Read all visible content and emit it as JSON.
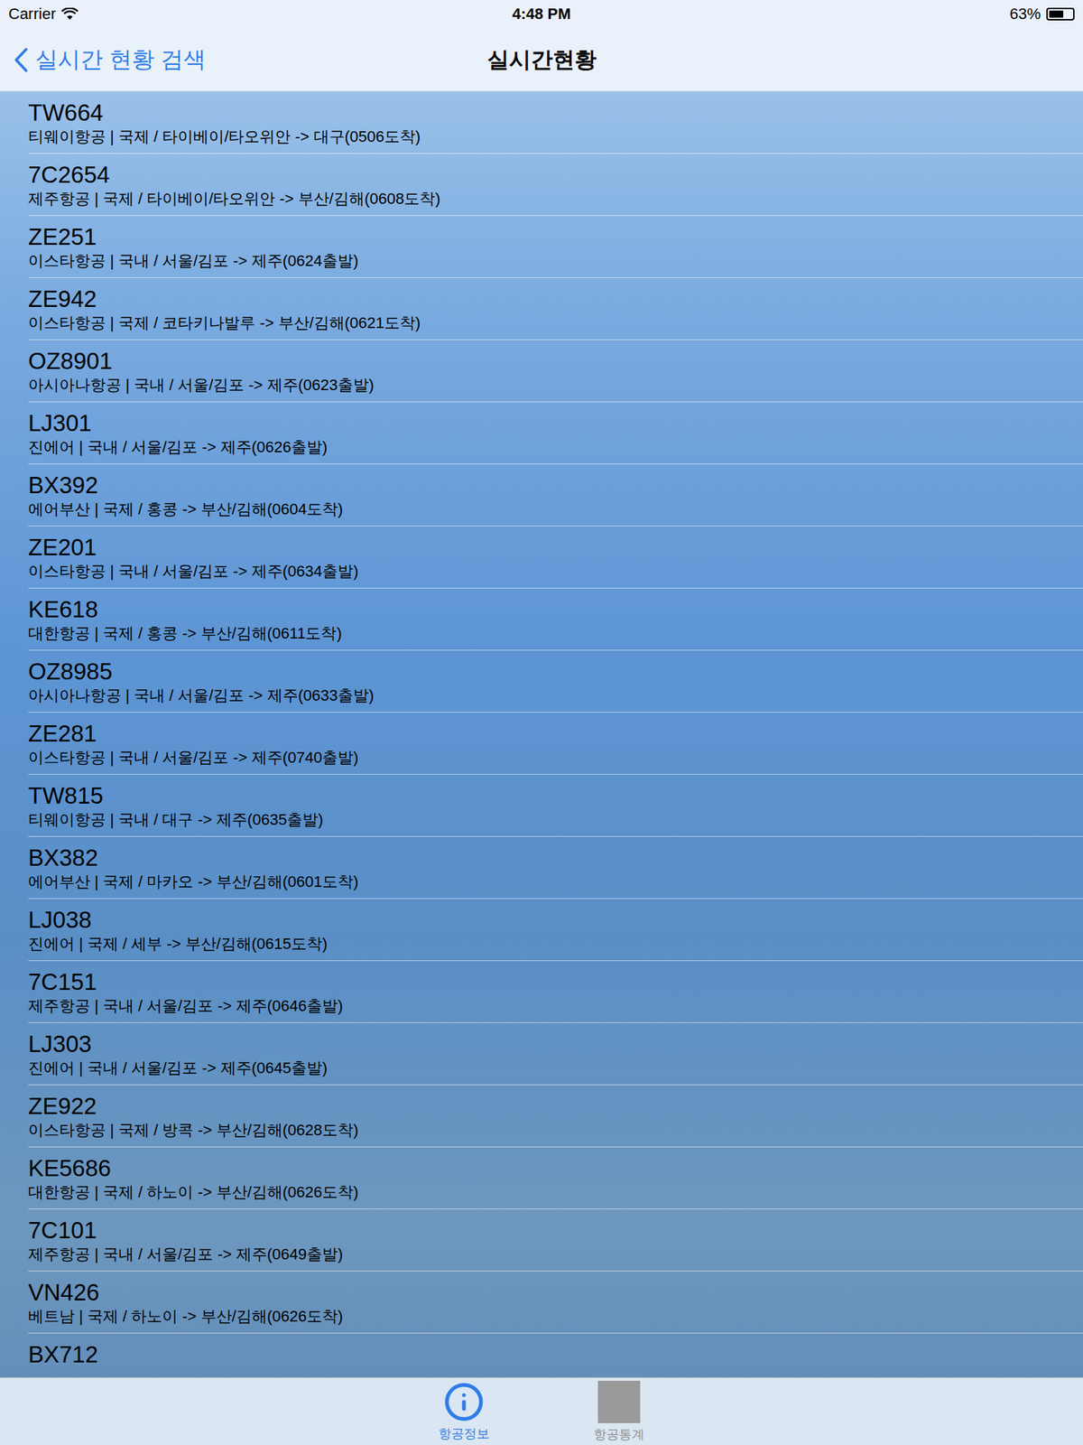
{
  "status_bar": {
    "carrier": "Carrier",
    "time": "4:48 PM",
    "battery": "63%",
    "battery_level": 0.63
  },
  "nav": {
    "back": "실시간 현황 검색",
    "title": "실시간현황"
  },
  "flights": [
    {
      "flight": "TW664",
      "detail": "티웨이항공 | 국제 / 타이베이/타오위안 -> 대구(0506도착)"
    },
    {
      "flight": "7C2654",
      "detail": "제주항공 | 국제 / 타이베이/타오위안 -> 부산/김해(0608도착)"
    },
    {
      "flight": "ZE251",
      "detail": "이스타항공 | 국내 / 서울/김포 -> 제주(0624출발)"
    },
    {
      "flight": "ZE942",
      "detail": "이스타항공 | 국제 / 코타키나발루 -> 부산/김해(0621도착)"
    },
    {
      "flight": "OZ8901",
      "detail": "아시아나항공 | 국내 / 서울/김포 -> 제주(0623출발)"
    },
    {
      "flight": "LJ301",
      "detail": "진에어 | 국내 / 서울/김포 -> 제주(0626출발)"
    },
    {
      "flight": "BX392",
      "detail": "에어부산 | 국제 / 홍콩 -> 부산/김해(0604도착)"
    },
    {
      "flight": "ZE201",
      "detail": "이스타항공 | 국내 / 서울/김포 -> 제주(0634출발)"
    },
    {
      "flight": "KE618",
      "detail": "대한항공 | 국제 / 홍콩 -> 부산/김해(0611도착)"
    },
    {
      "flight": "OZ8985",
      "detail": "아시아나항공 | 국내 / 서울/김포 -> 제주(0633출발)"
    },
    {
      "flight": "ZE281",
      "detail": "이스타항공 | 국내 / 서울/김포 -> 제주(0740출발)"
    },
    {
      "flight": "TW815",
      "detail": "티웨이항공 | 국내 / 대구 -> 제주(0635출발)"
    },
    {
      "flight": "BX382",
      "detail": "에어부산 | 국제 / 마카오 -> 부산/김해(0601도착)"
    },
    {
      "flight": "LJ038",
      "detail": "진에어 | 국제 / 세부 -> 부산/김해(0615도착)"
    },
    {
      "flight": "7C151",
      "detail": "제주항공 | 국내 / 서울/김포 -> 제주(0646출발)"
    },
    {
      "flight": "LJ303",
      "detail": "진에어 | 국내 / 서울/김포 -> 제주(0645출발)"
    },
    {
      "flight": "ZE922",
      "detail": "이스타항공 | 국제 / 방콕 -> 부산/김해(0628도착)"
    },
    {
      "flight": "KE5686",
      "detail": "대한항공 | 국제 / 하노이 -> 부산/김해(0626도착)"
    },
    {
      "flight": "7C101",
      "detail": "제주항공 | 국내 / 서울/김포 -> 제주(0649출발)"
    },
    {
      "flight": "VN426",
      "detail": "베트남 | 국제 / 하노이 -> 부산/김해(0626도착)"
    },
    {
      "flight": "BX712"
    }
  ],
  "tabs": [
    {
      "label": "항공정보",
      "selected": true,
      "kind": "info"
    },
    {
      "label": "항공통계",
      "selected": false,
      "kind": "square"
    }
  ]
}
